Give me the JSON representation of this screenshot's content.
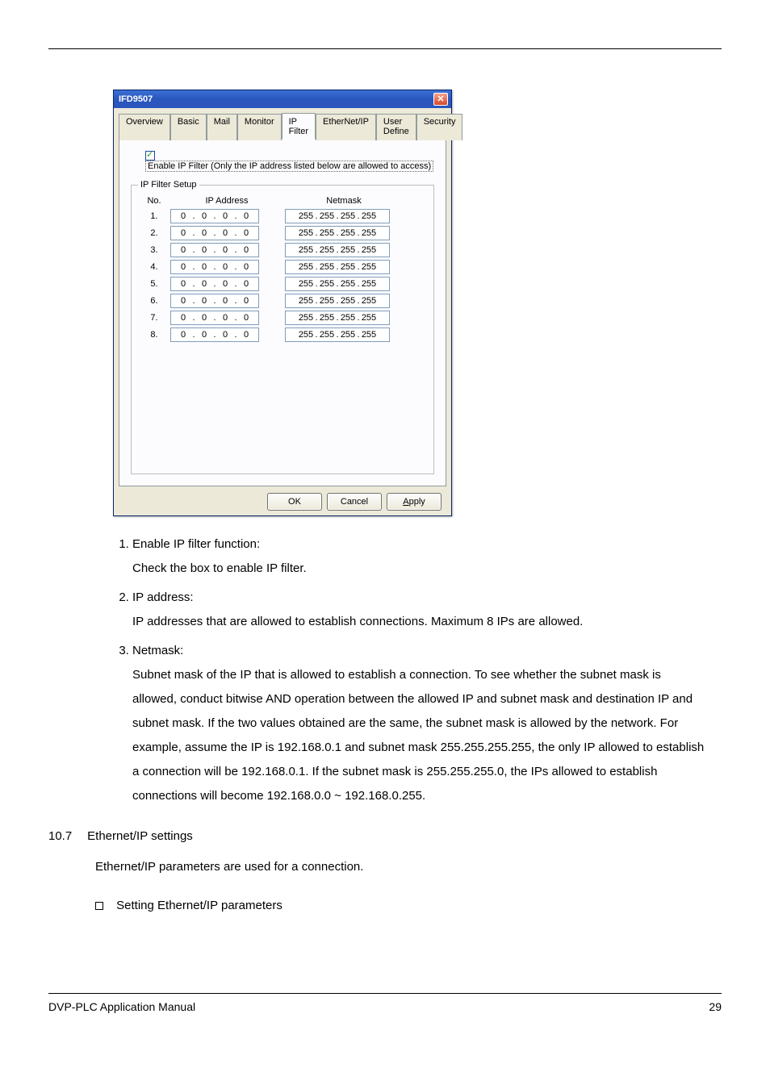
{
  "dialog": {
    "title": "IFD9507",
    "tabs": [
      "Overview",
      "Basic",
      "Mail",
      "Monitor",
      "IP Filter",
      "EtherNet/IP",
      "User Define",
      "Security"
    ],
    "active_tab_index": 4,
    "enable_checked": true,
    "enable_label": "Enable IP Filter  (Only the IP address listed below are allowed to access)",
    "group_legend": "IP Filter Setup",
    "headers": {
      "no": "No.",
      "ip": "IP Address",
      "nm": "Netmask"
    },
    "rows": [
      {
        "no": "1.",
        "ip": [
          "0",
          "0",
          "0",
          "0"
        ],
        "nm": [
          "255",
          "255",
          "255",
          "255"
        ]
      },
      {
        "no": "2.",
        "ip": [
          "0",
          "0",
          "0",
          "0"
        ],
        "nm": [
          "255",
          "255",
          "255",
          "255"
        ]
      },
      {
        "no": "3.",
        "ip": [
          "0",
          "0",
          "0",
          "0"
        ],
        "nm": [
          "255",
          "255",
          "255",
          "255"
        ]
      },
      {
        "no": "4.",
        "ip": [
          "0",
          "0",
          "0",
          "0"
        ],
        "nm": [
          "255",
          "255",
          "255",
          "255"
        ]
      },
      {
        "no": "5.",
        "ip": [
          "0",
          "0",
          "0",
          "0"
        ],
        "nm": [
          "255",
          "255",
          "255",
          "255"
        ]
      },
      {
        "no": "6.",
        "ip": [
          "0",
          "0",
          "0",
          "0"
        ],
        "nm": [
          "255",
          "255",
          "255",
          "255"
        ]
      },
      {
        "no": "7.",
        "ip": [
          "0",
          "0",
          "0",
          "0"
        ],
        "nm": [
          "255",
          "255",
          "255",
          "255"
        ]
      },
      {
        "no": "8.",
        "ip": [
          "0",
          "0",
          "0",
          "0"
        ],
        "nm": [
          "255",
          "255",
          "255",
          "255"
        ]
      }
    ],
    "buttons": {
      "ok": "OK",
      "cancel": "Cancel",
      "apply_prefix": "A",
      "apply_rest": "pply"
    }
  },
  "explain": {
    "items": [
      {
        "title": "Enable IP filter function:",
        "body": "Check the box to enable IP filter."
      },
      {
        "title": "IP address:",
        "body": "IP addresses that are allowed to establish connections. Maximum 8 IPs are allowed."
      },
      {
        "title": "Netmask:",
        "body": "Subnet mask of the IP that is allowed to establish a connection. To see whether the subnet mask is allowed, conduct bitwise AND operation between the allowed IP and subnet mask and destination IP and subnet mask. If the two values obtained are the same, the subnet mask is allowed by the network. For example, assume the IP is 192.168.0.1 and subnet mask 255.255.255.255, the only IP allowed to establish a connection will be 192.168.0.1. If the subnet mask is 255.255.255.0, the IPs allowed to establish connections will become 192.168.0.0 ~ 192.168.0.255."
      }
    ]
  },
  "section": {
    "number": "10.7",
    "title": "Ethernet/IP settings",
    "intro": "Ethernet/IP parameters are used for a connection.",
    "bullet": "Setting Ethernet/IP parameters"
  },
  "footer": {
    "left": "DVP-PLC Application Manual",
    "right": "29"
  }
}
